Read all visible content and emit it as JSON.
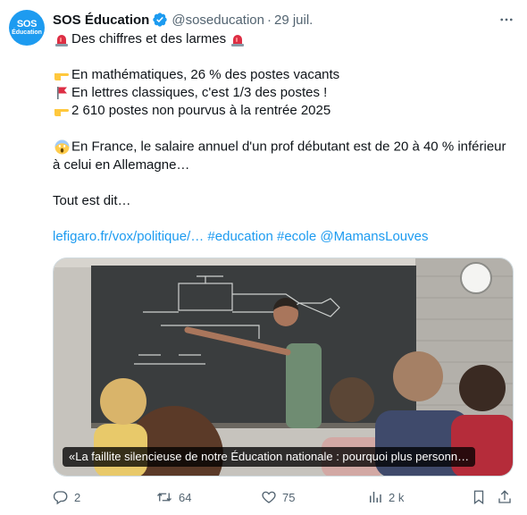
{
  "author": {
    "name": "SOS Éducation",
    "handle": "@soseducation",
    "separator": "·",
    "date": "29 juil.",
    "avatar_line1": "SOS",
    "avatar_line2": "Éducation"
  },
  "icons": {
    "verified": "verified-badge-icon",
    "more": "more-options-icon",
    "siren": "rotating-light-emoji",
    "pointing": "backhand-index-pointing-right-emoji",
    "flag": "triangular-flag-emoji",
    "scream": "face-screaming-in-fear-emoji",
    "reply": "reply-icon",
    "retweet": "retweet-icon",
    "like": "heart-icon",
    "views": "views-chart-icon",
    "bookmark": "bookmark-icon",
    "share": "share-icon"
  },
  "tweet": {
    "line1": "Des chiffres et des larmes",
    "line2": "En mathématiques, 26 % des postes vacants",
    "line3": "En lettres classiques, c'est 1/3 des postes !",
    "line4": "2 610 postes non pourvus à la rentrée 2025",
    "line5": "En France, le salaire annuel d'un prof débutant est de 20 à 40 % inférieur à celui en Allemagne…",
    "line6": "Tout est dit…",
    "link": "lefigaro.fr/vox/politique/…",
    "hashtag1": "#education",
    "hashtag2": "#ecole",
    "mention": "@MamansLouves"
  },
  "card": {
    "caption": "«La faillite silencieuse de notre Éducation nationale : pourquoi plus personn…"
  },
  "actions": {
    "replies": "2",
    "retweets": "64",
    "likes": "75",
    "views": "2 k"
  },
  "colors": {
    "accent": "#1d9bf0",
    "secondary_text": "#536471",
    "retweet_green": "#00ba7c"
  }
}
